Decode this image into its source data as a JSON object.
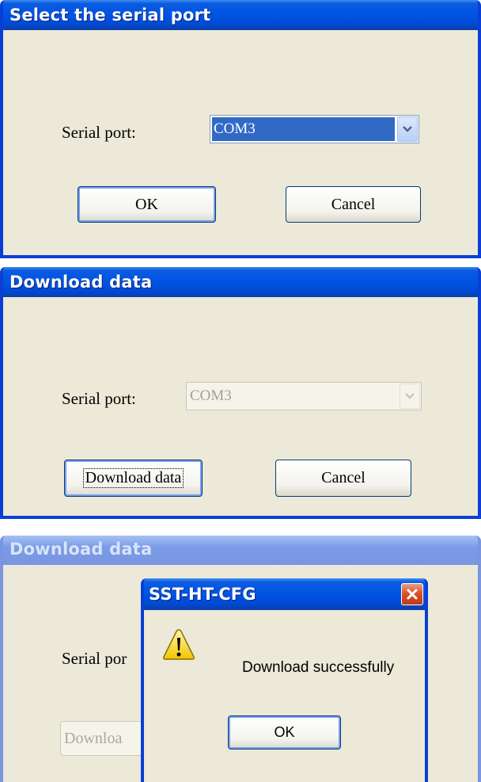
{
  "dialog1": {
    "title": "Select the serial port",
    "serial_port_label": "Serial port:",
    "serial_port_value": "COM3",
    "ok_label": "OK",
    "cancel_label": "Cancel"
  },
  "dialog2": {
    "title": "Download data",
    "serial_port_label": "Serial port:",
    "serial_port_value": "COM3",
    "download_label": "Download data",
    "cancel_label": "Cancel"
  },
  "dialog3": {
    "title": "Download data",
    "serial_port_label": "Serial por",
    "download_label": "Downloa"
  },
  "messagebox": {
    "title": "SST-HT-CFG",
    "message": "Download successfully",
    "ok_label": "OK",
    "icon": "warning-icon",
    "close_icon": "close-icon"
  },
  "colors": {
    "titlebar": "#0055e5",
    "window_bg": "#ece9d8",
    "selection": "#316ac5",
    "close_button": "#d9532d"
  }
}
